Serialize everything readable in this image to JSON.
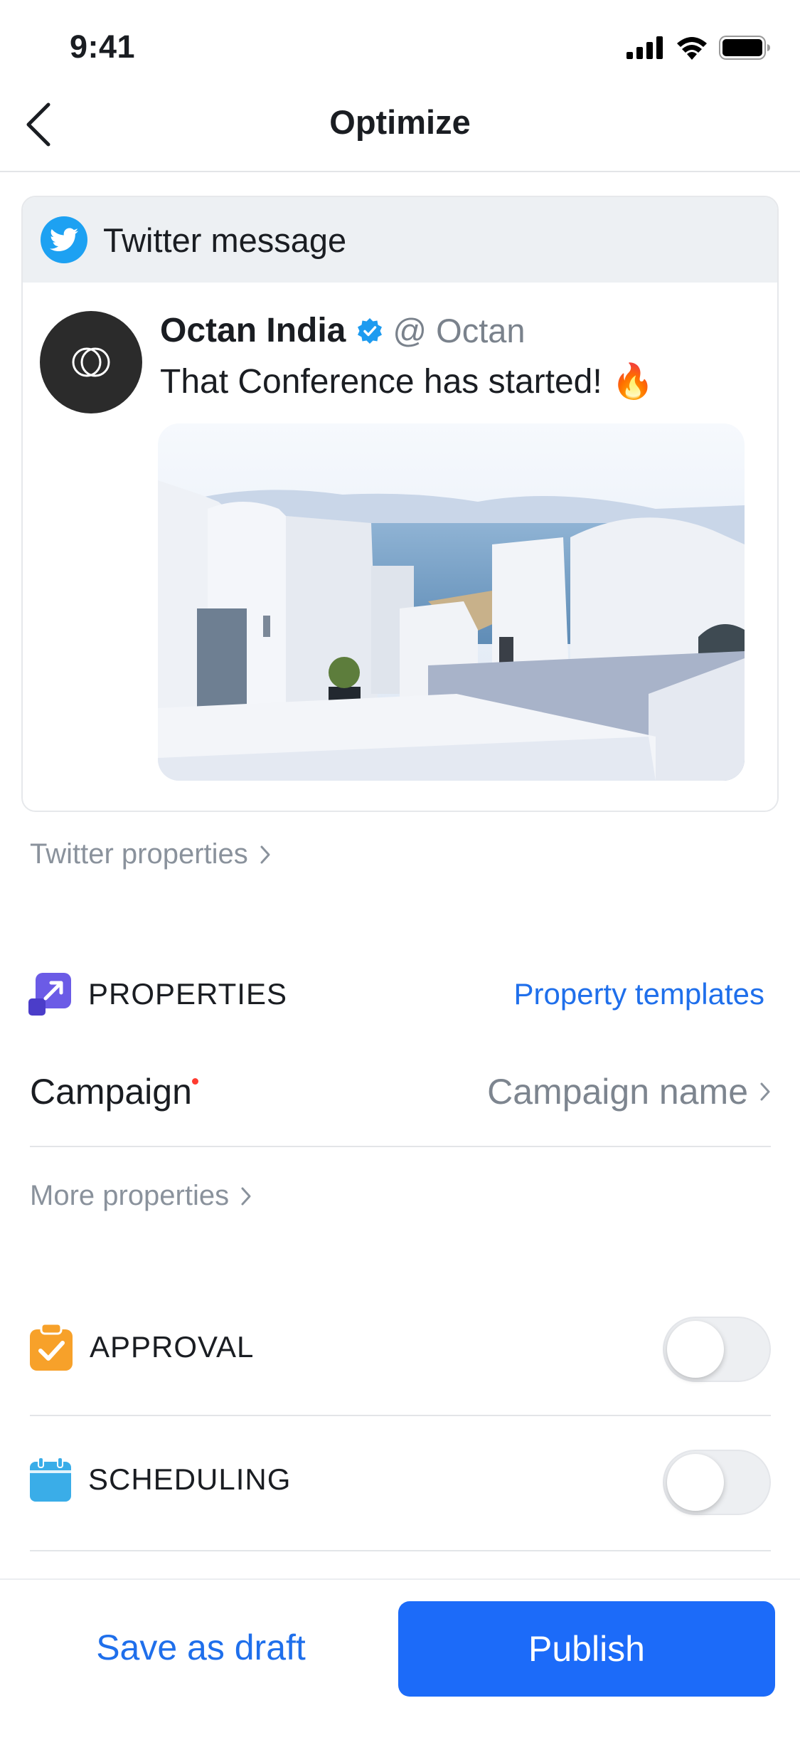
{
  "status_bar": {
    "time": "9:41"
  },
  "nav": {
    "title": "Optimize"
  },
  "message_card": {
    "header_label": "Twitter message",
    "author_name": "Octan India",
    "handle": "@ Octan",
    "text": "That Conference has started! 🔥"
  },
  "twitter_properties_link": "Twitter properties",
  "properties": {
    "heading": "PROPERTIES",
    "templates_link": "Property templates",
    "campaign": {
      "label": "Campaign",
      "placeholder": "Campaign name",
      "required": true
    },
    "more_link": "More properties"
  },
  "approval": {
    "heading": "APPROVAL",
    "enabled": false
  },
  "scheduling": {
    "heading": "SCHEDULING",
    "enabled": false
  },
  "actions": {
    "draft_label": "Save as draft",
    "publish_label": "Publish"
  },
  "colors": {
    "accent": "#1C6BF9",
    "twitter": "#1DA1F2",
    "approval": "#F7A12A",
    "scheduling": "#3AADE8",
    "properties": "#6652E0"
  }
}
